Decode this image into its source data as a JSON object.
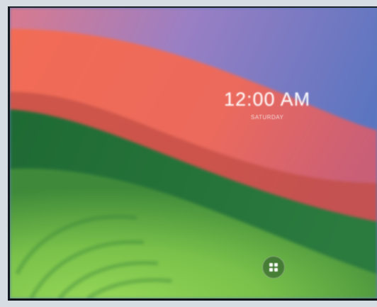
{
  "lock_screen": {
    "time": "12:00 AM",
    "date": "SATURDAY",
    "login_icon": "windows-grid-icon"
  },
  "colors": {
    "wallpaper_purple": "#7d79c6",
    "wallpaper_red": "#ee6a55",
    "wallpaper_dark_green": "#1f6a34",
    "wallpaper_light_green": "#7dc54a"
  }
}
